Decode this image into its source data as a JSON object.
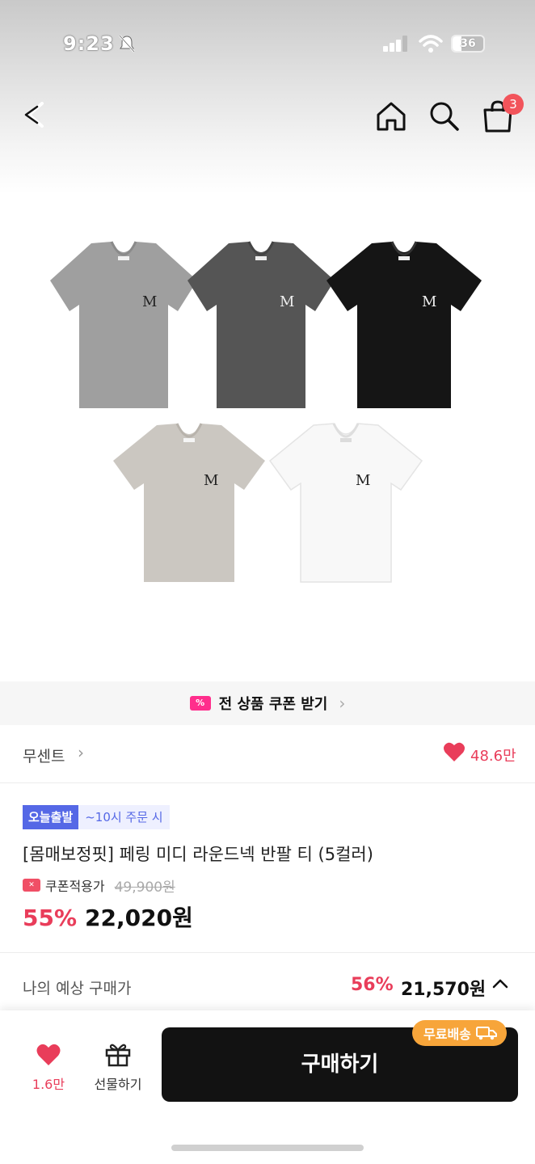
{
  "status_bar": {
    "time": "9:23",
    "battery": "36"
  },
  "nav": {
    "cart_count": "3"
  },
  "products": {
    "colors": [
      "#9f9f9f",
      "#555555",
      "#151515",
      "#cbc7c1",
      "#f8f8f8"
    ],
    "logo": "M"
  },
  "coupon_banner": {
    "text": "전 상품 쿠폰 받기"
  },
  "brand": {
    "name": "무센트",
    "like_count": "48.6만"
  },
  "product": {
    "badge_today": "오늘출발",
    "badge_time": "~10시 주문 시",
    "title": "[몸매보정핏] 페링 미디 라운드넥 반팔 티 (5컬러)",
    "coupon_applied": "쿠폰적용가",
    "original_price": "49,900원",
    "discount": "55%",
    "price": "22,020원"
  },
  "expected": {
    "label": "나의 예상 구매가",
    "discount": "56%",
    "price": "21,570원"
  },
  "bottom_bar": {
    "wish_count": "1.6만",
    "gift_label": "선물하기",
    "buy_label": "구매하기",
    "free_shipping": "무료배송"
  }
}
